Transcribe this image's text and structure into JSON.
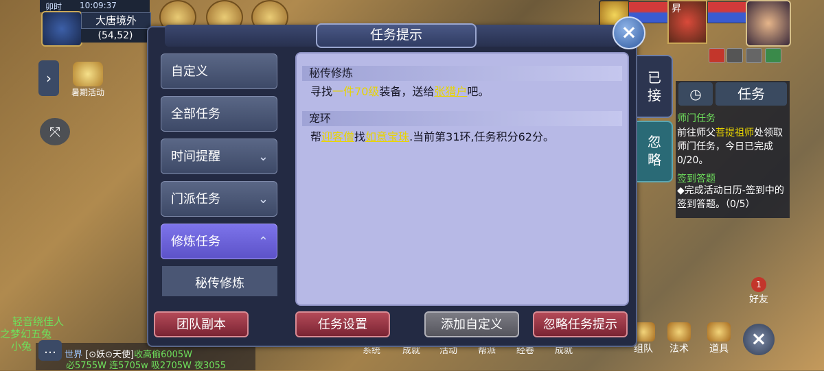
{
  "hud": {
    "time_tag": "卯时",
    "time": "10:09:37",
    "map_name": "大唐境外",
    "coords": "(54,52)",
    "summer_activity": "暑期活动",
    "hero_name": "昇"
  },
  "dialog": {
    "title": "任务提示",
    "close_icon": "×"
  },
  "categories": [
    {
      "label": "自定义"
    },
    {
      "label": "全部任务"
    },
    {
      "label": "时间提醒"
    },
    {
      "label": "门派任务"
    },
    {
      "label": "修炼任务"
    }
  ],
  "sub_item": "秘传修炼",
  "quests": {
    "q1_header": "秘传修炼",
    "q1_a": "寻找",
    "q1_b": "一件70级",
    "q1_c": "装备，送给",
    "q1_d": "张猎户",
    "q1_e": "吧。",
    "q2_header": "宠环",
    "q2_a": "帮",
    "q2_b": "迎客僧",
    "q2_c": "找",
    "q2_d": "如意宝珠",
    "q2_e": ".当前第31环,任务积分62分。"
  },
  "side_tabs": {
    "accepted": "已接",
    "ignore": "忽略"
  },
  "buttons": {
    "team_dungeon": "团队副本",
    "task_settings": "任务设置",
    "add_custom": "添加自定义",
    "ignore_prompt": "忽略任务提示"
  },
  "tracker": {
    "tab_label": "任务",
    "t1": "师门任务",
    "t1_a": "前往师父",
    "t1_b": "菩提祖师",
    "t1_c": "处领取师门任务，今日已完成0/20。",
    "t2": "签到答题",
    "t2_text": "◆完成活动日历-签到中的签到答题。（0/5）"
  },
  "right_bottom": {
    "friends": "好友",
    "friends_badge": "1",
    "team": "组队",
    "magic": "法术",
    "items": "道具"
  },
  "bottom_menu": [
    "系统",
    "成就",
    "活动",
    "帮派",
    "经卷",
    "成就"
  ],
  "chat": {
    "channel": "世界",
    "line1_a": "[⊙妖⊙",
    "line1_b": "天使]",
    "line1_c": "收高偷6005W",
    "line2": "必5755W 连5705w 吸2705W 夜3055"
  },
  "npc": {
    "n1": "轻音绕佳人",
    "n2": "之梦幻五兔",
    "n3": "小兔"
  }
}
